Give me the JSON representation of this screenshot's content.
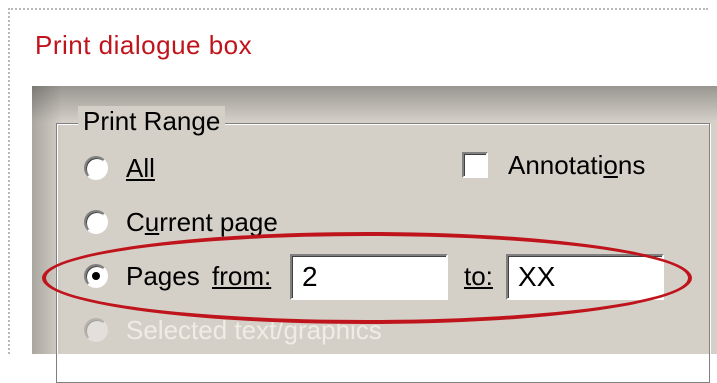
{
  "caption": "Print dialogue box",
  "print_range": {
    "legend": "Print Range",
    "options": {
      "all": {
        "label": "All",
        "selected": false
      },
      "current_page": {
        "label_pre": "C",
        "label_mnemonic": "u",
        "label_post": "rrent page",
        "selected": false
      },
      "pages": {
        "label": "Pages",
        "from_label": "from:",
        "to_label": "to:",
        "from_value": "2",
        "to_value": "XX",
        "selected": true
      },
      "selection": {
        "label": "Selected text/graphics",
        "selected": false
      }
    },
    "annotations": {
      "label_pre": "Annotati",
      "label_mnemonic": "o",
      "label_post": "ns",
      "checked": false
    }
  },
  "colors": {
    "caption": "#c0141c",
    "highlight": "#c0141c",
    "dialog_bg": "#d4d0c8"
  }
}
